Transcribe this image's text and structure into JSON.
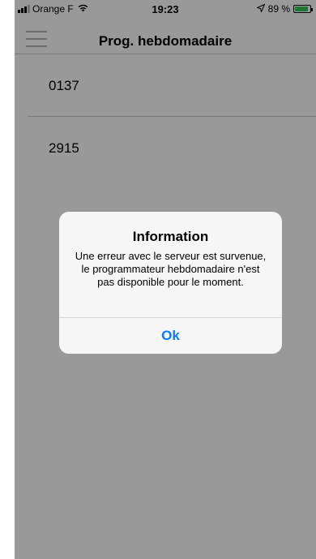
{
  "status_bar": {
    "carrier": "Orange F",
    "time": "19:23",
    "battery_text": "89 %",
    "battery_level": 0.89,
    "battery_color": "#34c759",
    "location_icon": "location-arrow-icon",
    "wifi_icon": "wifi-icon"
  },
  "nav": {
    "title": "Prog. hebdomadaire",
    "menu_icon": "hamburger-menu-icon"
  },
  "list": {
    "items": [
      {
        "label": "0137"
      },
      {
        "label": "2915"
      }
    ]
  },
  "alert": {
    "title": "Information",
    "message": "Une erreur avec le serveur est survenue, le programmateur hebdomadaire n'est pas disponible pour le moment.",
    "button_label": "Ok",
    "accent_color": "#0a7aff"
  }
}
